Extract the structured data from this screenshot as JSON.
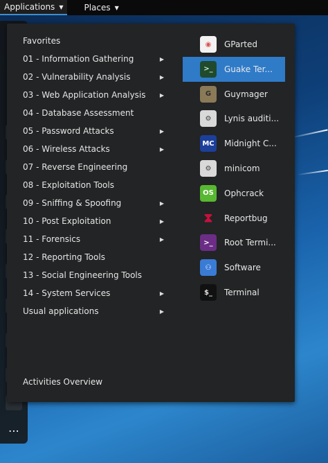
{
  "topbar": {
    "applications_label": "Applications",
    "places_label": "Places"
  },
  "categories": [
    {
      "label": "Favorites",
      "has_submenu": false
    },
    {
      "label": "01 - Information Gathering",
      "has_submenu": true
    },
    {
      "label": "02 - Vulnerability Analysis",
      "has_submenu": true
    },
    {
      "label": "03 - Web Application Analysis",
      "has_submenu": true
    },
    {
      "label": "04 - Database Assessment",
      "has_submenu": false
    },
    {
      "label": "05 - Password Attacks",
      "has_submenu": true
    },
    {
      "label": "06 - Wireless Attacks",
      "has_submenu": true
    },
    {
      "label": "07 - Reverse Engineering",
      "has_submenu": false
    },
    {
      "label": "08 - Exploitation Tools",
      "has_submenu": false
    },
    {
      "label": "09 - Sniffing & Spoofing",
      "has_submenu": true
    },
    {
      "label": "10 - Post Exploitation",
      "has_submenu": true
    },
    {
      "label": "11 - Forensics",
      "has_submenu": true
    },
    {
      "label": "12 - Reporting Tools",
      "has_submenu": false
    },
    {
      "label": "13 - Social Engineering Tools",
      "has_submenu": false
    },
    {
      "label": "14 - System Services",
      "has_submenu": true
    },
    {
      "label": "Usual applications",
      "has_submenu": true
    }
  ],
  "activities_label": "Activities Overview",
  "apps": [
    {
      "label": "GParted",
      "icon": "gparted-icon",
      "selected": false
    },
    {
      "label": "Guake Ter...",
      "icon": "guake-terminal-icon",
      "selected": true
    },
    {
      "label": "Guymager",
      "icon": "guymager-icon",
      "selected": false
    },
    {
      "label": "Lynis auditi...",
      "icon": "lynis-icon",
      "selected": false
    },
    {
      "label": "Midnight C...",
      "icon": "midnight-commander-icon",
      "selected": false
    },
    {
      "label": "minicom",
      "icon": "minicom-icon",
      "selected": false
    },
    {
      "label": "Ophcrack",
      "icon": "ophcrack-icon",
      "selected": false
    },
    {
      "label": "Reportbug",
      "icon": "reportbug-icon",
      "selected": false
    },
    {
      "label": "Root Termi...",
      "icon": "root-terminal-icon",
      "selected": false
    },
    {
      "label": "Software",
      "icon": "software-icon",
      "selected": false
    },
    {
      "label": "Terminal",
      "icon": "terminal-icon",
      "selected": false
    }
  ],
  "colors": {
    "selection": "#2f7bc8",
    "panel": "#222425",
    "topbar": "#0a0a0a"
  }
}
